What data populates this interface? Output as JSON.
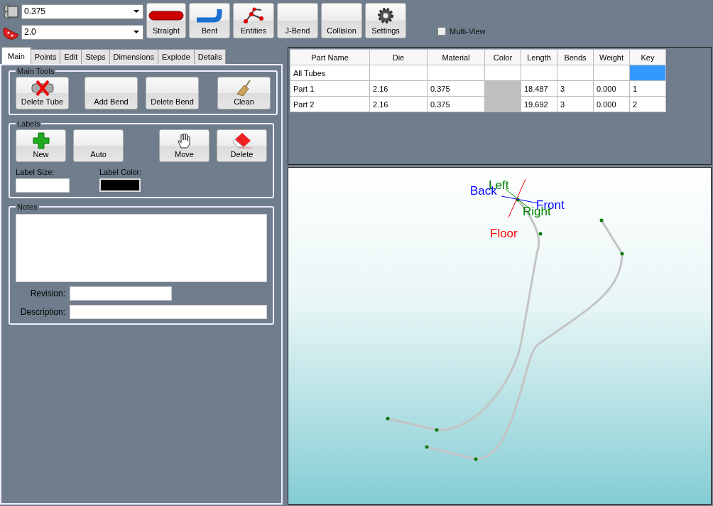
{
  "toolbar": {
    "diameter": "0.375",
    "radius": "2.0",
    "buttons": [
      {
        "label": "Straight",
        "kind": "straight"
      },
      {
        "label": "Bent",
        "kind": "bent"
      },
      {
        "label": "Entities",
        "kind": "entities"
      },
      {
        "label": "J-Bend",
        "kind": "none"
      },
      {
        "label": "Collision",
        "kind": "none"
      },
      {
        "label": "Settings",
        "kind": "settings"
      }
    ],
    "multi_view": {
      "label": "Multi-View",
      "checked": false
    }
  },
  "tabs": [
    {
      "label": "Main",
      "selected": true
    },
    {
      "label": "Points",
      "selected": false
    },
    {
      "label": "Edit",
      "selected": false
    },
    {
      "label": "Steps",
      "selected": false
    },
    {
      "label": "Dimensions",
      "selected": false
    },
    {
      "label": "Explode",
      "selected": false
    },
    {
      "label": "Details",
      "selected": false
    }
  ],
  "main_tools": {
    "title": "Main Tools",
    "buttons": [
      {
        "label": "Delete Tube",
        "kind": "delete-tube"
      },
      {
        "label": "Add Bend",
        "kind": "none"
      },
      {
        "label": "Delete Bend",
        "kind": "none"
      },
      {
        "label": "Clean",
        "kind": "broom"
      }
    ]
  },
  "labels": {
    "title": "Labels",
    "buttons": [
      {
        "label": "New",
        "kind": "plus"
      },
      {
        "label": "Auto",
        "kind": "none"
      },
      {
        "label": "Move",
        "kind": "hand"
      },
      {
        "label": "Delete",
        "kind": "eraser"
      }
    ],
    "size_label": "Label Size:",
    "color_label": "Label Color:"
  },
  "notes": {
    "title": "Notes",
    "revision_label": "Revision:",
    "description_label": "Description:"
  },
  "table": {
    "columns": [
      "Part Name",
      "Die",
      "Material",
      "Color",
      "Length",
      "Bends",
      "Weight",
      "Key"
    ],
    "rows": [
      {
        "name": "All Tubes",
        "die": "",
        "material": "",
        "length": "",
        "bends": "",
        "weight": "",
        "key": "",
        "selected": true
      },
      {
        "name": "Part 1",
        "die": "2.16",
        "material": "0.375",
        "color": "#c0c0c0",
        "length": "18.487",
        "bends": "3",
        "weight": "0.000",
        "key": "1",
        "selected": false
      },
      {
        "name": "Part 2",
        "die": "2.16",
        "material": "0.375",
        "color": "#c0c0c0",
        "length": "19.692",
        "bends": "3",
        "weight": "0.000",
        "key": "2",
        "selected": false
      }
    ]
  },
  "viewport": {
    "axis_labels": [
      {
        "text": "Left",
        "color": "#008000"
      },
      {
        "text": "Back",
        "color": "#0000ff"
      },
      {
        "text": "Front",
        "color": "#0000ff"
      },
      {
        "text": "Right",
        "color": "#008000"
      },
      {
        "text": "Floor",
        "color": "#ff0000"
      }
    ]
  }
}
